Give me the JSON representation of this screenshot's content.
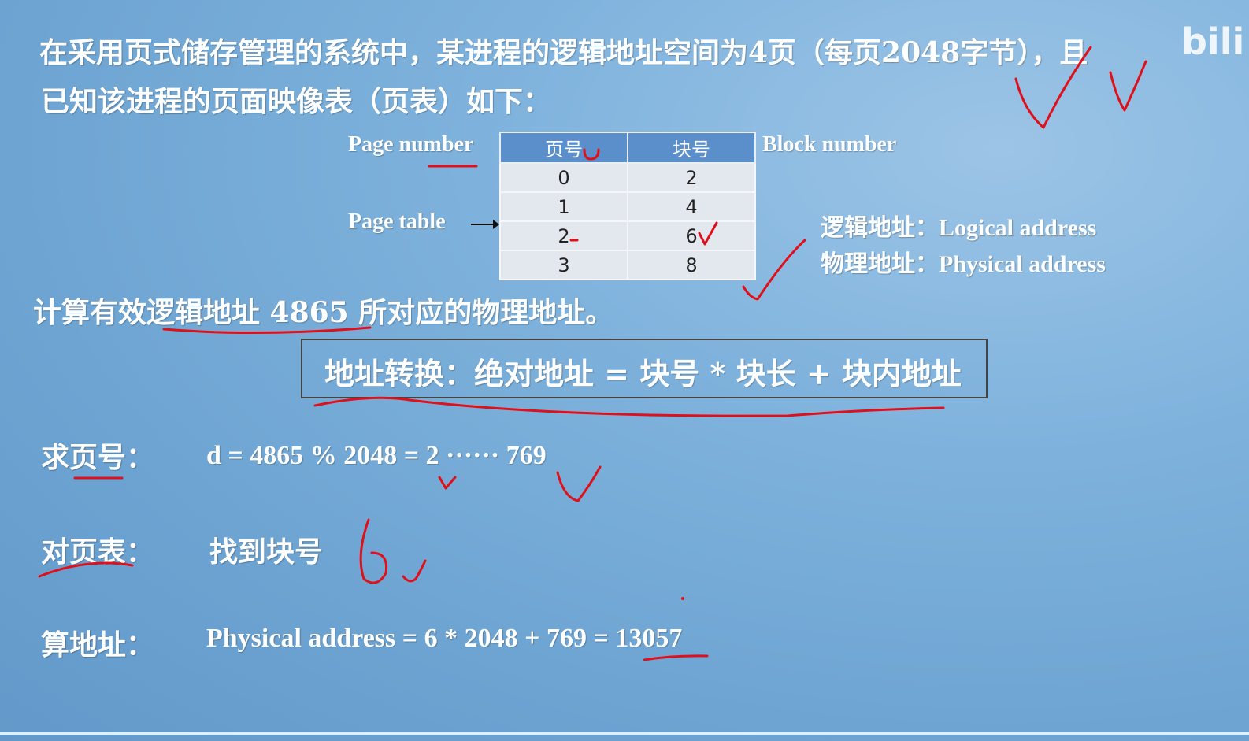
{
  "problem": {
    "line1": "在采用页式储存管理的系统中，某进程的逻辑地址空间为4页（每页2048字节），且",
    "line2": "已知该进程的页面映像表（页表）如下："
  },
  "labels": {
    "page_number": "Page number",
    "page_table": "Page table",
    "block_number": "Block number",
    "logical": "逻辑地址：Logical address",
    "physical": "物理地址：Physical address"
  },
  "table": {
    "headers": [
      "页号",
      "块号"
    ],
    "rows": [
      [
        "0",
        "2"
      ],
      [
        "1",
        "4"
      ],
      [
        "2",
        "6"
      ],
      [
        "3",
        "8"
      ]
    ]
  },
  "question": "计算有效逻辑地址 4865 所对应的物理地址。",
  "formula": "地址转换：绝对地址 = 块号 * 块长 + 块内地址",
  "steps": [
    {
      "label": "求页号：",
      "content": "d = 4865 % 2048 = 2 ······ 769"
    },
    {
      "label": "对页表：",
      "content": "找到块号"
    },
    {
      "label": "算地址：",
      "content": "Physical address = 6 * 2048 + 769 = 13057"
    }
  ],
  "watermark": "bili",
  "annotation_color": "#e0101a"
}
